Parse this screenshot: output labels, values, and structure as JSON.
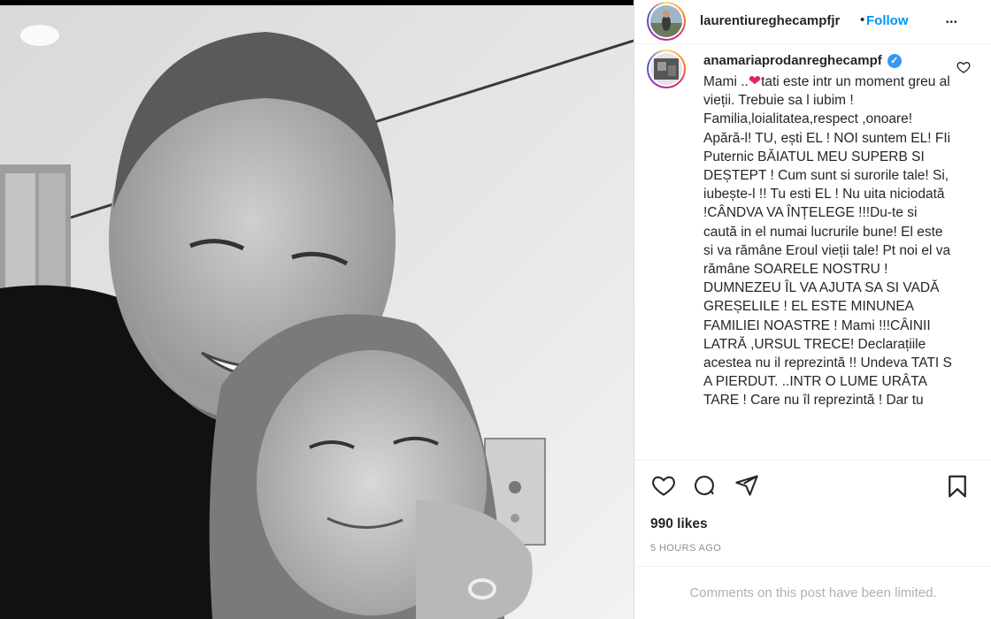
{
  "post": {
    "username": "laurentiureghecampfjr",
    "follow_separator": "•",
    "follow_label": "Follow",
    "more_label": "•••"
  },
  "comment": {
    "username": "anamariaprodanreghecampf",
    "verified_mark": "✓",
    "text_before_heart": "Mami ..",
    "heart": "❤",
    "text_after_heart": "tati este intr un moment greu al vieții. Trebuie sa l iubim ! Familia,loialitatea,respect ,onoare! Apără-l! TU, ești EL ! NOI suntem EL! FIi Puternic BĂIATUL MEU SUPERB SI DEȘTEPT ! Cum sunt si surorile tale! Si, iubește-l !! Tu esti EL ! Nu uita niciodată !CÂNDVA VA ÎNȚELEGE !!!Du-te si caută in el numai lucrurile bune! El este si va rămâne Eroul vieții tale! Pt noi el va rămâne SOARELE NOSTRU ! DUMNEZEU ÎL VA AJUTA SA SI VADĂ GREȘELILE ! EL ESTE MINUNEA FAMILIEI NOASTRE ! Mami !!!CÂINII LATRĂ ,URSUL TRECE! Declarațiile acestea nu il reprezintă !! Undeva TATI S A PIERDUT. ..INTR O LUME URÂTA TARE ! Care nu îl reprezintă ! Dar tu"
  },
  "actions": {
    "icons": [
      "heart-icon",
      "comment-icon",
      "share-icon",
      "bookmark-icon"
    ]
  },
  "likes_label": "990 likes",
  "timestamp": "5 HOURS AGO",
  "comments_limited": "Comments on this post have been limited.",
  "colors": {
    "link_blue": "#0095f6",
    "verified_blue": "#3897f0",
    "heart_red": "#e0245e",
    "muted_gray": "#8e8e8e"
  }
}
